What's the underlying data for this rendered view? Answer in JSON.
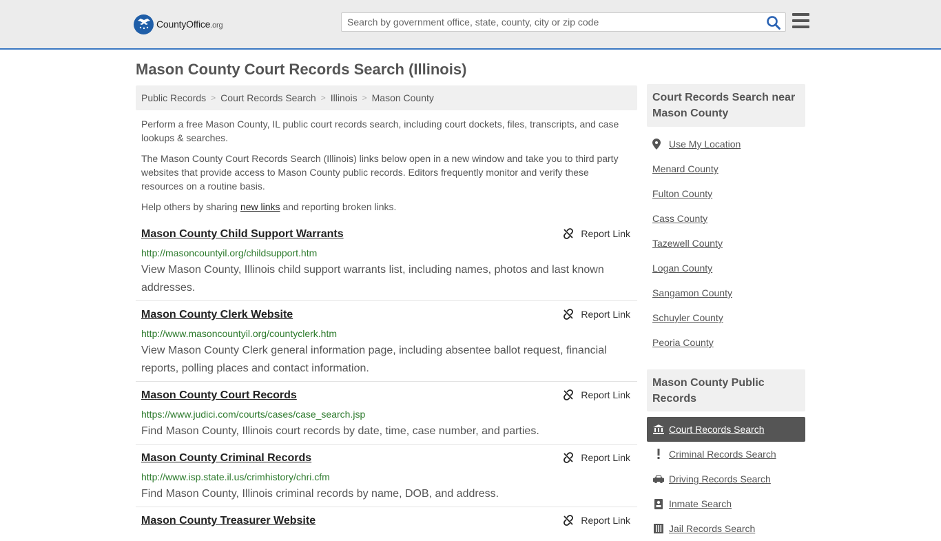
{
  "header": {
    "logo_brand": "CountyOffice",
    "logo_tld": ".org",
    "search_placeholder": "Search by government office, state, county, city or zip code"
  },
  "page_title": "Mason County Court Records Search (Illinois)",
  "breadcrumb": [
    "Public Records",
    "Court Records Search",
    "Illinois",
    "Mason County"
  ],
  "intro": {
    "p1": "Perform a free Mason County, IL public court records search, including court dockets, files, transcripts, and case lookups & searches.",
    "p2": "The Mason County Court Records Search (Illinois) links below open in a new window and take you to third party websites that provide access to Mason County public records. Editors frequently monitor and verify these resources on a routine basis.",
    "p3_before": "Help others by sharing ",
    "p3_link": "new links",
    "p3_after": " and reporting broken links."
  },
  "report_label": "Report Link",
  "records": [
    {
      "title": "Mason County Child Support Warrants",
      "url": "http://masoncountyil.org/childsupport.htm",
      "desc": "View Mason County, Illinois child support warrants list, including names, photos and last known addresses."
    },
    {
      "title": "Mason County Clerk Website",
      "url": "http://www.masoncountyil.org/countyclerk.htm",
      "desc": "View Mason County Clerk general information page, including absentee ballot request, financial reports, polling places and contact information."
    },
    {
      "title": "Mason County Court Records",
      "url": "https://www.judici.com/courts/cases/case_search.jsp",
      "desc": "Find Mason County, Illinois court records by date, time, case number, and parties."
    },
    {
      "title": "Mason County Criminal Records",
      "url": "http://www.isp.state.il.us/crimhistory/chri.cfm",
      "desc": "Find Mason County, Illinois criminal records by name, DOB, and address."
    },
    {
      "title": "Mason County Treasurer Website",
      "url": "",
      "desc": ""
    }
  ],
  "sidebar": {
    "near_heading": "Court Records Search near Mason County",
    "use_location": "Use My Location",
    "nearby": [
      "Menard County",
      "Fulton County",
      "Cass County",
      "Tazewell County",
      "Logan County",
      "Sangamon County",
      "Schuyler County",
      "Peoria County"
    ],
    "public_heading": "Mason County Public Records",
    "public_items": [
      {
        "label": "Court Records Search",
        "icon": "courthouse-icon",
        "active": true
      },
      {
        "label": "Criminal Records Search",
        "icon": "exclamation-icon",
        "active": false
      },
      {
        "label": "Driving Records Search",
        "icon": "car-icon",
        "active": false
      },
      {
        "label": "Inmate Search",
        "icon": "id-card-icon",
        "active": false
      },
      {
        "label": "Jail Records Search",
        "icon": "jail-icon",
        "active": false
      }
    ]
  }
}
